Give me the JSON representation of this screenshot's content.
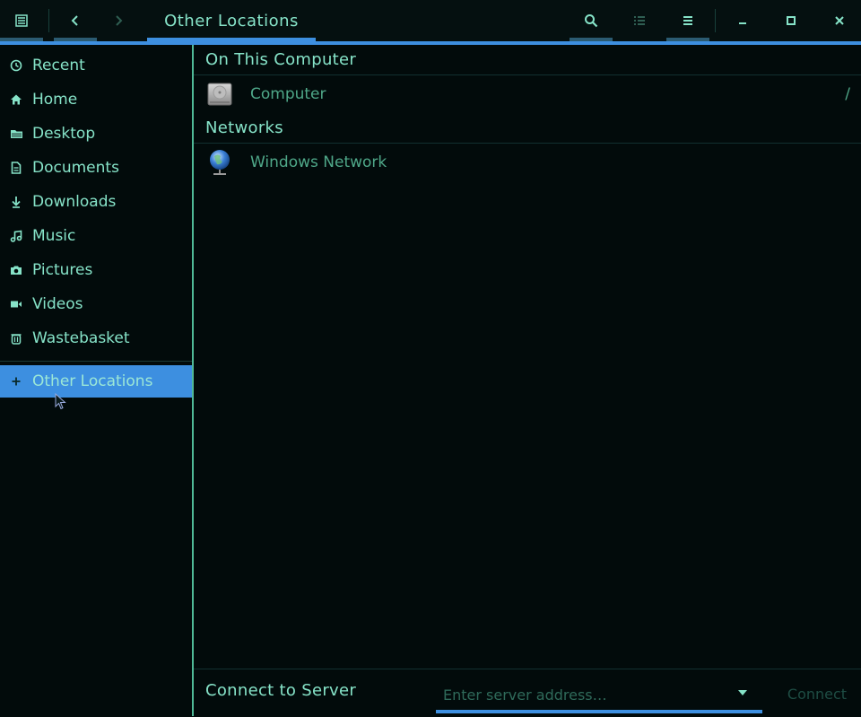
{
  "window": {
    "title": "Other Locations"
  },
  "toolbar": {
    "icons": [
      "app-menu-icon",
      "back-icon",
      "forward-icon",
      "search-icon",
      "list-view-icon",
      "hamburger-menu-icon",
      "minimize-icon",
      "maximize-icon",
      "close-icon"
    ]
  },
  "sidebar": {
    "items": [
      {
        "label": "Recent",
        "icon": "clock-icon"
      },
      {
        "label": "Home",
        "icon": "home-icon"
      },
      {
        "label": "Desktop",
        "icon": "folder-icon"
      },
      {
        "label": "Documents",
        "icon": "document-icon"
      },
      {
        "label": "Downloads",
        "icon": "download-icon"
      },
      {
        "label": "Music",
        "icon": "music-icon"
      },
      {
        "label": "Pictures",
        "icon": "camera-icon"
      },
      {
        "label": "Videos",
        "icon": "video-icon"
      },
      {
        "label": "Wastebasket",
        "icon": "trash-icon"
      }
    ],
    "other_locations": {
      "label": "Other Locations",
      "icon": "plus-icon"
    }
  },
  "main": {
    "on_this_computer": {
      "title": "On This Computer",
      "items": [
        {
          "label": "Computer",
          "path": "/",
          "icon": "hard-drive-icon"
        }
      ]
    },
    "networks": {
      "title": "Networks",
      "items": [
        {
          "label": "Windows Network",
          "icon": "network-globe-icon"
        }
      ]
    }
  },
  "connect": {
    "label": "Connect to Server",
    "placeholder": "Enter server address…",
    "button": "Connect"
  },
  "colors": {
    "accent": "#3d8fe0",
    "text": "#86e3c8",
    "background": "#020b0b",
    "border": "#4fb896"
  }
}
